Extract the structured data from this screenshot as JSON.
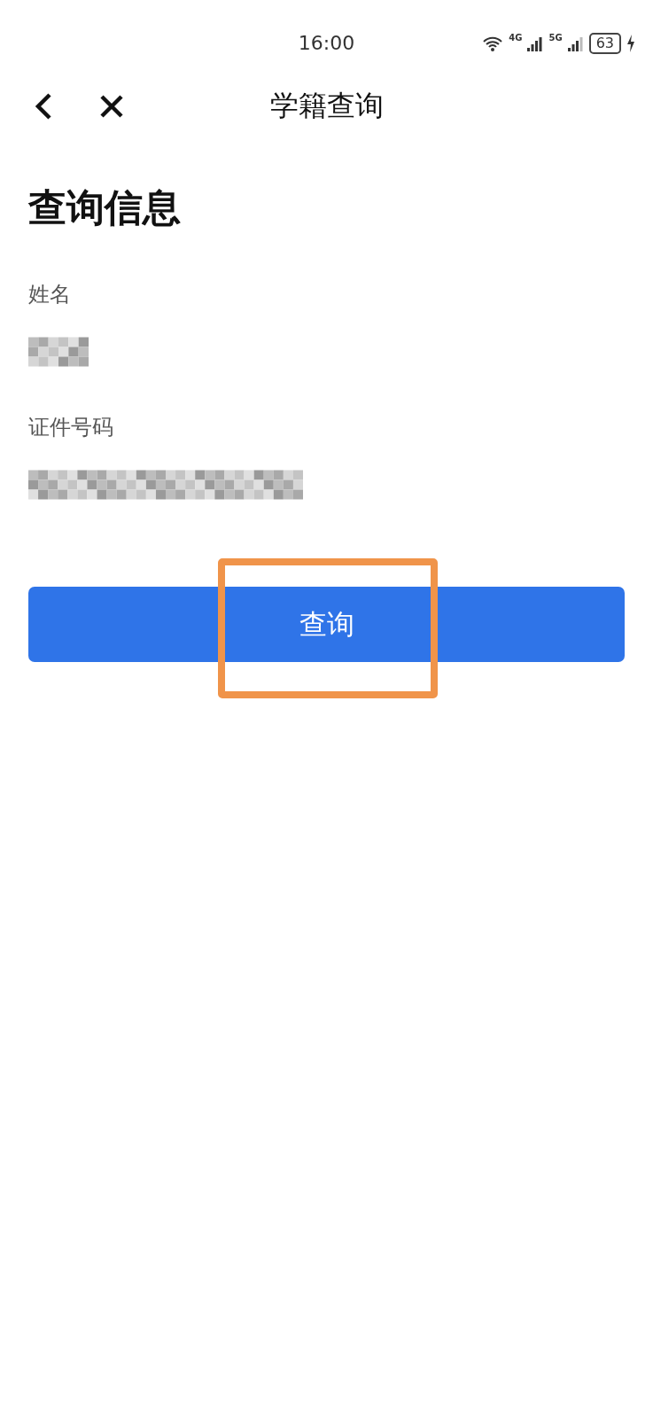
{
  "status_bar": {
    "time": "16:00",
    "battery": "63",
    "network_1": "4G",
    "network_2": "5G"
  },
  "nav": {
    "title": "学籍查询"
  },
  "heading": "查询信息",
  "fields": [
    {
      "label": "姓名",
      "kind": "short"
    },
    {
      "label": "证件号码",
      "kind": "long"
    }
  ],
  "button": {
    "label": "查询",
    "highlighted": true
  }
}
